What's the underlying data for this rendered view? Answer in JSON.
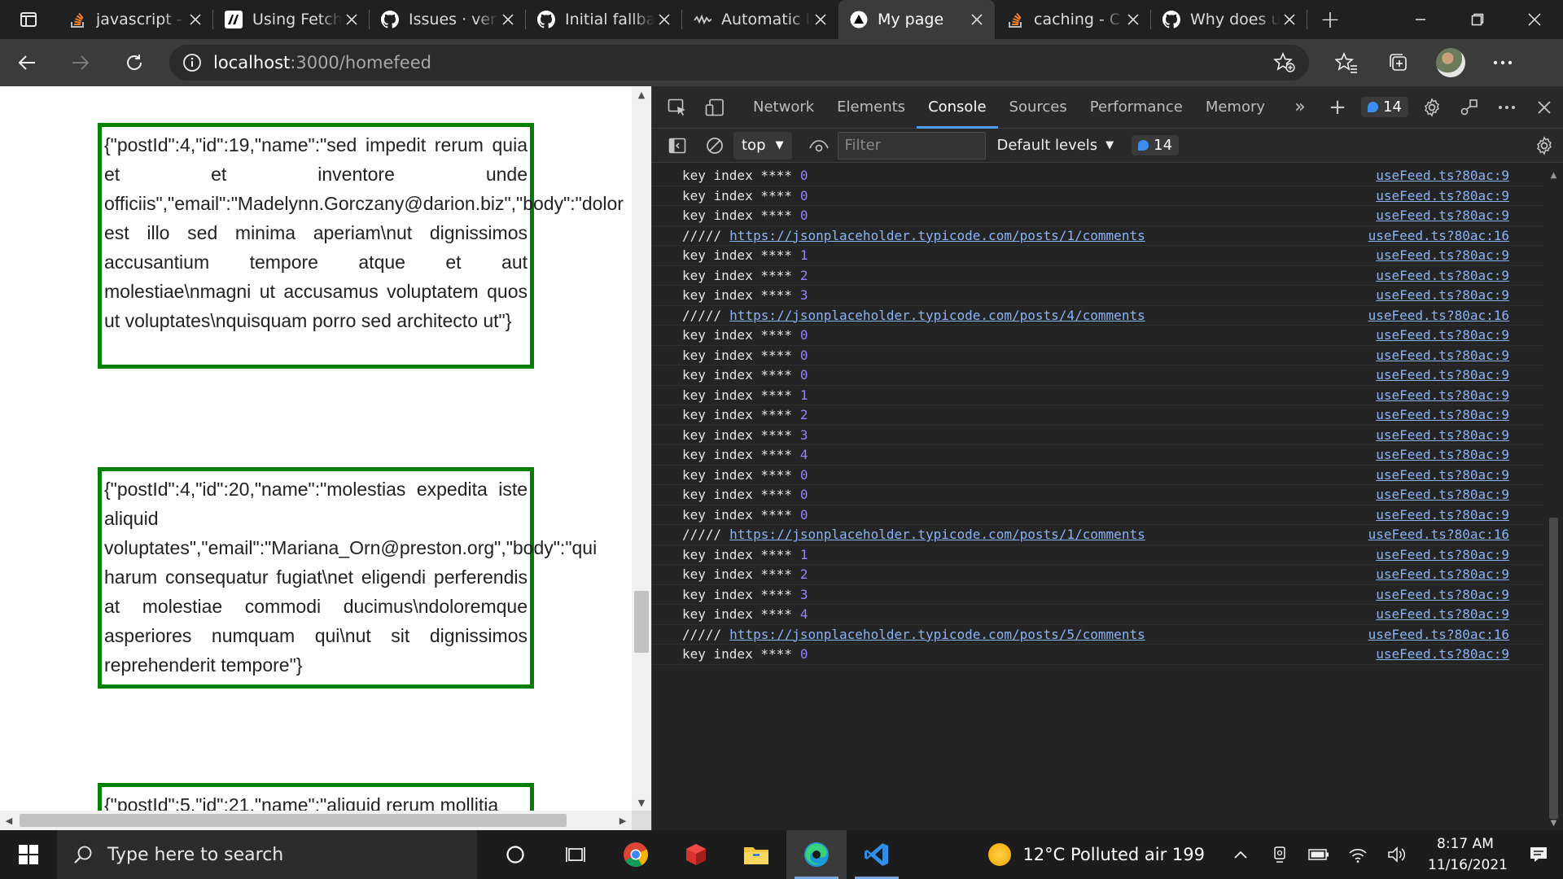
{
  "browser": {
    "tabs": [
      {
        "title": "javascript -",
        "favicon": "stackoverflow-icon"
      },
      {
        "title": "Using Fetch",
        "favicon": "mdn-icon"
      },
      {
        "title": "Issues · verc",
        "favicon": "github-icon"
      },
      {
        "title": "Initial fallba",
        "favicon": "github-icon"
      },
      {
        "title": "Automatic I",
        "favicon": "wave-icon"
      },
      {
        "title": "My page",
        "favicon": "vercel-icon",
        "active": true
      },
      {
        "title": "caching - C",
        "favicon": "stackoverflow-icon"
      },
      {
        "title": "Why does u",
        "favicon": "github-icon"
      }
    ],
    "address": {
      "host": "localhost",
      "path": ":3000/homefeed"
    }
  },
  "page": {
    "cards": [
      {
        "text": "{\"postId\":4,\"id\":19,\"name\":\"sed impedit rerum quia et et inventore unde officiis\",\"email\":\"Madelynn.Gorczany@darion.biz\",\"body\":\"dolor est illo sed minima aperiam\\nut dignissimos accusantium tempore atque et aut molestiae\\nmagni ut accusamus voluptatem quos ut voluptates\\nquisquam porro sed architecto ut\"}"
      },
      {
        "text": "{\"postId\":4,\"id\":20,\"name\":\"molestias expedita iste aliquid voluptates\",\"email\":\"Mariana_Orn@preston.org\",\"body\":\"qui harum consequatur fugiat\\net eligendi perferendis at molestiae commodi ducimus\\ndoloremque asperiores numquam qui\\nut sit dignissimos reprehenderit tempore\"}"
      },
      {
        "text": "{\"postId\":5,\"id\":21,\"name\":\"aliquid rerum mollitia"
      }
    ]
  },
  "devtools": {
    "tabs": [
      "Network",
      "Elements",
      "Console",
      "Sources",
      "Performance",
      "Memory"
    ],
    "active_tab": "Console",
    "message_count": "14",
    "context": "top",
    "filter_placeholder": "Filter",
    "levels": "Default levels",
    "console_lines": [
      {
        "type": "log",
        "text": "key index ****",
        "num": "0",
        "src": "useFeed.ts?80ac:9"
      },
      {
        "type": "log",
        "text": "key index ****",
        "num": "0",
        "src": "useFeed.ts?80ac:9"
      },
      {
        "type": "log",
        "text": "key index ****",
        "num": "0",
        "src": "useFeed.ts?80ac:9"
      },
      {
        "type": "url",
        "text": "/////",
        "url": "https://jsonplaceholder.typicode.com/posts/1/comments",
        "src": "useFeed.ts?80ac:16"
      },
      {
        "type": "log",
        "text": "key index ****",
        "num": "1",
        "src": "useFeed.ts?80ac:9"
      },
      {
        "type": "log",
        "text": "key index ****",
        "num": "2",
        "src": "useFeed.ts?80ac:9"
      },
      {
        "type": "log",
        "text": "key index ****",
        "num": "3",
        "src": "useFeed.ts?80ac:9"
      },
      {
        "type": "url",
        "text": "/////",
        "url": "https://jsonplaceholder.typicode.com/posts/4/comments",
        "src": "useFeed.ts?80ac:16"
      },
      {
        "type": "log",
        "text": "key index ****",
        "num": "0",
        "src": "useFeed.ts?80ac:9"
      },
      {
        "type": "log",
        "text": "key index ****",
        "num": "0",
        "src": "useFeed.ts?80ac:9"
      },
      {
        "type": "log",
        "text": "key index ****",
        "num": "0",
        "src": "useFeed.ts?80ac:9"
      },
      {
        "type": "log",
        "text": "key index ****",
        "num": "1",
        "src": "useFeed.ts?80ac:9"
      },
      {
        "type": "log",
        "text": "key index ****",
        "num": "2",
        "src": "useFeed.ts?80ac:9"
      },
      {
        "type": "log",
        "text": "key index ****",
        "num": "3",
        "src": "useFeed.ts?80ac:9"
      },
      {
        "type": "log",
        "text": "key index ****",
        "num": "4",
        "src": "useFeed.ts?80ac:9"
      },
      {
        "type": "log",
        "text": "key index ****",
        "num": "0",
        "src": "useFeed.ts?80ac:9"
      },
      {
        "type": "log",
        "text": "key index ****",
        "num": "0",
        "src": "useFeed.ts?80ac:9"
      },
      {
        "type": "log",
        "text": "key index ****",
        "num": "0",
        "src": "useFeed.ts?80ac:9"
      },
      {
        "type": "url",
        "text": "/////",
        "url": "https://jsonplaceholder.typicode.com/posts/1/comments",
        "src": "useFeed.ts?80ac:16"
      },
      {
        "type": "log",
        "text": "key index ****",
        "num": "1",
        "src": "useFeed.ts?80ac:9"
      },
      {
        "type": "log",
        "text": "key index ****",
        "num": "2",
        "src": "useFeed.ts?80ac:9"
      },
      {
        "type": "log",
        "text": "key index ****",
        "num": "3",
        "src": "useFeed.ts?80ac:9"
      },
      {
        "type": "log",
        "text": "key index ****",
        "num": "4",
        "src": "useFeed.ts?80ac:9"
      },
      {
        "type": "url",
        "text": "/////",
        "url": "https://jsonplaceholder.typicode.com/posts/5/comments",
        "src": "useFeed.ts?80ac:16"
      },
      {
        "type": "log",
        "text": "key index ****",
        "num": "0",
        "src": "useFeed.ts?80ac:9"
      }
    ]
  },
  "taskbar": {
    "search_placeholder": "Type here to search",
    "weather": "12°C  Polluted air 199",
    "time": "8:17 AM",
    "date": "11/16/2021"
  },
  "colors": {
    "card_border": "#008000",
    "console_number": "#9980ff",
    "console_link": "#8ab4f8",
    "devtools_accent": "#4c9cf4"
  }
}
